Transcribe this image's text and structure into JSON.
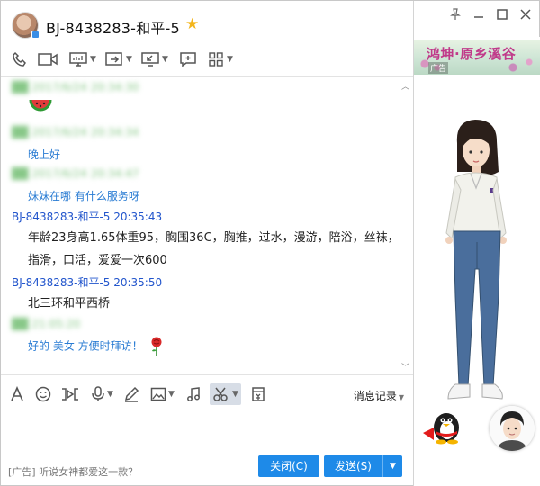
{
  "window": {
    "title": "BJ-8438283-和平-5"
  },
  "chat": {
    "messages": [
      {
        "header": "██ 2017/6/24 20:34:30",
        "blurred": true,
        "content_type": "emoji",
        "emoji": "watermelon-icon"
      },
      {
        "header": "██ 2017/6/24 20:34:34",
        "blurred": true,
        "text": "晚上好"
      },
      {
        "header": "██ 2017/6/24 20:34:47",
        "blurred": true,
        "text": "妹妹在哪   有什么服务呀"
      },
      {
        "header": "BJ-8438283-和平-5   20:35:43",
        "blurred": false,
        "line1": "年龄23身高1.65体重95，胸围36C，胸推，过水，漫游，陪浴，丝袜，",
        "line2": "指滑，口活，爱爱一次600"
      },
      {
        "header": "BJ-8438283-和平-5   20:35:50",
        "blurred": false,
        "text": "北三环和平西桥"
      },
      {
        "header": "██  21:05:20",
        "blurred": true,
        "text": "好的  美女 方便时拜访！",
        "emoji": "rose-icon"
      }
    ]
  },
  "input_toolbar": {
    "history_label": "消息记录"
  },
  "footer": {
    "ad_text": "[广告] 听说女神都爱这一款？",
    "close_label": "关闭(C)",
    "send_label": "发送(S)"
  },
  "side_panel": {
    "banner_text": "鸿坤·原乡溪谷",
    "banner_tag": "广告"
  },
  "colors": {
    "accent": "#1e8ae8",
    "sender": "#2255cc",
    "own_message": "#2a7cd3"
  }
}
